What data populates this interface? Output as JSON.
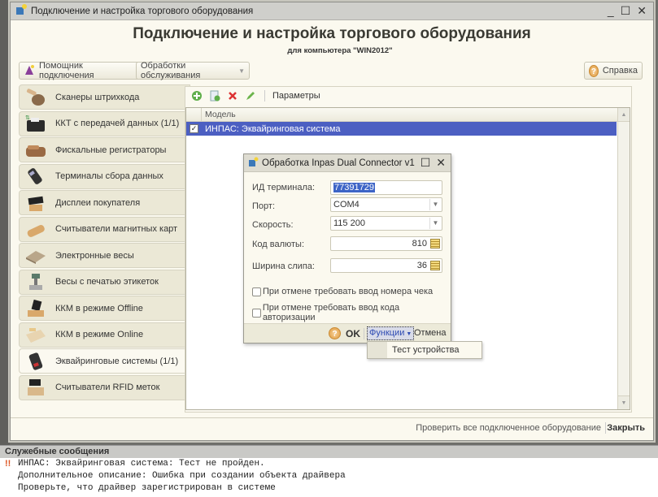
{
  "window": {
    "title": "Подключение и настройка торгового оборудования",
    "controls": {
      "minimize": "_",
      "maximize": "☐",
      "close": "✕"
    }
  },
  "header": {
    "title": "Подключение и настройка торгового оборудования",
    "subtitle": "для компьютера \"WIN2012\""
  },
  "top_buttons": {
    "wizard": "Помощник подключения",
    "service": "Обработки обслуживания",
    "help": "Справка"
  },
  "sidebar": {
    "items": [
      {
        "label": "Сканеры штрихкода",
        "icon": "barcode-scanner-icon"
      },
      {
        "label": "ККТ с передачей данных (1/1)",
        "icon": "online-cash-register-icon"
      },
      {
        "label": "Фискальные регистраторы",
        "icon": "fiscal-printer-icon"
      },
      {
        "label": "Терминалы сбора данных",
        "icon": "data-terminal-icon"
      },
      {
        "label": "Дисплеи покупателя",
        "icon": "customer-display-icon"
      },
      {
        "label": "Считыватели магнитных карт",
        "icon": "card-reader-icon"
      },
      {
        "label": "Электронные весы",
        "icon": "scales-icon"
      },
      {
        "label": "Весы с печатью этикеток",
        "icon": "label-scales-icon"
      },
      {
        "label": "ККМ в режиме Offline",
        "icon": "offline-register-icon"
      },
      {
        "label": "ККМ в режиме Online",
        "icon": "online-register-icon"
      },
      {
        "label": "Эквайринговые системы (1/1)",
        "icon": "pos-terminal-icon",
        "active": true
      },
      {
        "label": "Считыватели RFID меток",
        "icon": "rfid-reader-icon"
      }
    ]
  },
  "toolbar": {
    "params_label": "Параметры"
  },
  "grid": {
    "columns": [
      "Модель"
    ],
    "rows": [
      {
        "checked": true,
        "model": "ИНПАС: Эквайринговая система",
        "selected": true
      }
    ]
  },
  "footer": {
    "check_all": "Проверить все подключенное оборудование",
    "close": "Закрыть"
  },
  "dialog": {
    "title": "Обработка  Inpas Dual Connector v1",
    "fields": {
      "terminal_id": {
        "label": "ИД терминала:",
        "value": "77391729"
      },
      "port": {
        "label": "Порт:",
        "value": "COM4"
      },
      "speed": {
        "label": "Скорость:",
        "value": "115 200"
      },
      "currency": {
        "label": "Код валюты:",
        "value": "810"
      },
      "slip_width": {
        "label": "Ширина слипа:",
        "value": "36"
      }
    },
    "checkboxes": [
      {
        "label": "При отмене требовать ввод номера чека",
        "checked": false
      },
      {
        "label": "При отмене требовать ввод кода авторизации",
        "checked": false
      }
    ],
    "buttons": {
      "ok": "OK",
      "functions": "Функции",
      "cancel": "Отмена"
    }
  },
  "functions_menu": {
    "items": [
      "Тест устройства"
    ]
  },
  "messages": {
    "title": "Служебные сообщения",
    "lines": [
      "ИНПАС: Эквайринговая система: Тест не пройден.",
      "Дополнительное описание: Ошибка при создании объекта драйвера",
      "Проверьте, что драйвер зарегистрирован в системе"
    ],
    "marker": "!!"
  },
  "colors": {
    "selection": "#4c5fc2",
    "window_bg": "#fbf9ef",
    "sidebar_bg": "#ebe8d6"
  }
}
